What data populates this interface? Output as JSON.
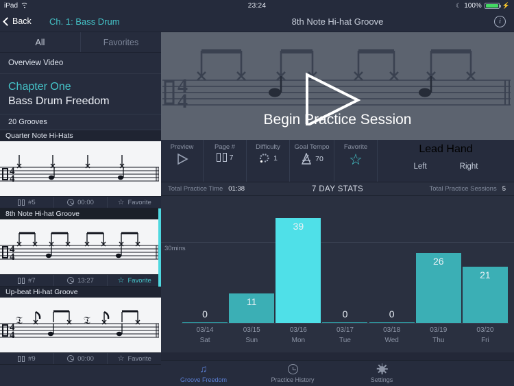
{
  "statusbar": {
    "device": "iPad",
    "time": "23:24",
    "battery": "100%"
  },
  "sidebar": {
    "back_label": "Back",
    "chapter_title": "Ch. 1: Bass Drum",
    "tabs": [
      {
        "label": "All",
        "active": true
      },
      {
        "label": "Favorites",
        "active": false
      }
    ],
    "overview_video": "Overview Video",
    "chapter_label": "Chapter One",
    "chapter_name": "Bass Drum Freedom",
    "groove_count": "20 Grooves",
    "grooves": [
      {
        "title": "Quarter Note Hi-Hats",
        "page": "#5",
        "time": "00:00",
        "favorite_label": "Favorite",
        "favorited": false,
        "selected": false
      },
      {
        "title": "8th Note Hi-hat Groove",
        "page": "#7",
        "time": "13:27",
        "favorite_label": "Favorite",
        "favorited": true,
        "selected": true
      },
      {
        "title": "Up-beat Hi-hat Groove",
        "page": "#9",
        "time": "00:00",
        "favorite_label": "Favorite",
        "favorited": false,
        "selected": false
      }
    ]
  },
  "content": {
    "title": "8th Note Hi-hat Groove",
    "info_label": "i",
    "hero_cta": "Begin Practice Session",
    "toolbar": {
      "preview_label": "Preview",
      "page_label": "Page #",
      "page_value": "7",
      "difficulty_label": "Difficulty",
      "difficulty_value": "1",
      "tempo_label": "Goal Tempo",
      "tempo_value": "70",
      "favorite_label": "Favorite",
      "lead_hand_label": "Lead Hand",
      "lead_left": "Left",
      "lead_right": "Right"
    },
    "stats": {
      "total_time_label": "Total Practice Time",
      "total_time_value": "01:38",
      "center_title": "7 DAY STATS",
      "sessions_label": "Total Practice Sessions",
      "sessions_value": "5"
    }
  },
  "chart_data": {
    "type": "bar",
    "title": "7 DAY STATS",
    "xlabel": "",
    "ylabel": "30mins",
    "ylim": [
      0,
      45
    ],
    "grid": true,
    "gridlines": [
      30
    ],
    "categories": [
      "03/14",
      "03/15",
      "03/16",
      "03/17",
      "03/18",
      "03/19",
      "03/20"
    ],
    "category_sublabels": [
      "Sat",
      "Sun",
      "Mon",
      "Tue",
      "Wed",
      "Thu",
      "Fri"
    ],
    "values": [
      0,
      11,
      39,
      0,
      0,
      26,
      21
    ],
    "colors": {
      "bar": "#3bafb5",
      "max_bar": "#4fe0e8",
      "zero_bar": "#2f9ba2"
    },
    "legend": []
  },
  "tabbar": [
    {
      "label": "Groove Freedom",
      "icon": "music-note-icon",
      "active": true
    },
    {
      "label": "Practice History",
      "icon": "clock-icon",
      "active": false
    },
    {
      "label": "Settings",
      "icon": "gear-icon",
      "active": false
    }
  ],
  "colors": {
    "accent": "#45c4c9",
    "selection": "#4fd8e0",
    "tab_active": "#5b7fd4"
  }
}
